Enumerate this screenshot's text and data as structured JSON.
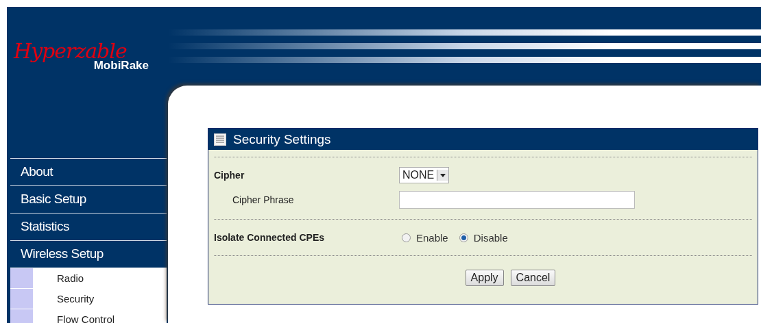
{
  "logo": {
    "script": "Hyperzable",
    "product": "MobiRake"
  },
  "sidebar": {
    "items": [
      {
        "label": "About",
        "kind": "main"
      },
      {
        "label": "Basic Setup",
        "kind": "main"
      },
      {
        "label": "Statistics",
        "kind": "main"
      },
      {
        "label": "Wireless Setup",
        "kind": "main"
      },
      {
        "label": "Radio",
        "kind": "sub"
      },
      {
        "label": "Security",
        "kind": "sub"
      },
      {
        "label": "Flow Control",
        "kind": "sub"
      }
    ]
  },
  "panel": {
    "title": "Security Settings",
    "cipher": {
      "label": "Cipher",
      "value": "NONE"
    },
    "cipher_phrase": {
      "label": "Cipher Phrase"
    },
    "isolate": {
      "label": "Isolate Connected CPEs",
      "options": [
        {
          "label": "Enable",
          "selected": false
        },
        {
          "label": "Disable",
          "selected": true
        }
      ]
    },
    "buttons": [
      "Apply",
      "Cancel"
    ]
  }
}
